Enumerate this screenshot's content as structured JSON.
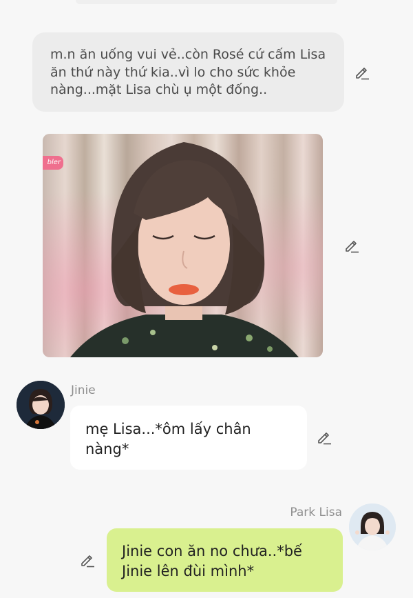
{
  "narration": {
    "text": "m.n ăn uống vui vẻ..còn Rosé cứ cấm Lisa ăn thứ này thứ kia..vì lo cho sức khỏe nàng...mặt Lisa chù ụ một đống.."
  },
  "photo": {
    "tag": "bler"
  },
  "messages": [
    {
      "sender": "Jinie",
      "text": "mẹ Lisa...*ôm lấy chân nàng*"
    },
    {
      "sender": "Park Lisa",
      "text": "Jinie con ăn no chưa..*bế Jinie lên đùi mình*"
    }
  ],
  "colors": {
    "background": "#f7f7f7",
    "narration_bubble": "#ececec",
    "incoming_bubble": "#ffffff",
    "outgoing_bubble": "#d9f08f",
    "sender_name": "#8e8e8e"
  },
  "icons": [
    "edit-icon"
  ]
}
